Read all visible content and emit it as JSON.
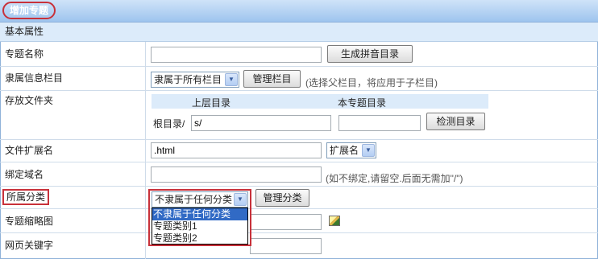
{
  "header": {
    "title": "增加专题"
  },
  "section": {
    "title": "基本属性"
  },
  "fields": {
    "name": {
      "label": "专题名称",
      "value": "",
      "button": "生成拼音目录"
    },
    "column": {
      "label": "隶属信息栏目",
      "selected": "隶属于所有栏目",
      "button": "管理栏目",
      "hint": "(选择父栏目，将应用于子栏目)"
    },
    "folder": {
      "label": "存放文件夹",
      "col_parent": "上层目录",
      "col_self": "本专题目录",
      "root_label": "根目录/",
      "parent_value": "s/",
      "self_value": "",
      "button": "检测目录"
    },
    "ext": {
      "label": "文件扩展名",
      "value": ".html",
      "select": "扩展名"
    },
    "domain": {
      "label": "绑定域名",
      "value": "",
      "hint": "(如不绑定,请留空.后面无需加\"/\")"
    },
    "category": {
      "label": "所属分类",
      "selected": "不隶属于任何分类",
      "button": "管理分类",
      "options": [
        "不隶属于任何分类",
        "专题类别1",
        "专题类别2"
      ]
    },
    "thumb": {
      "label": "专题缩略图"
    },
    "keywords": {
      "label": "网页关键字",
      "value": ""
    }
  }
}
